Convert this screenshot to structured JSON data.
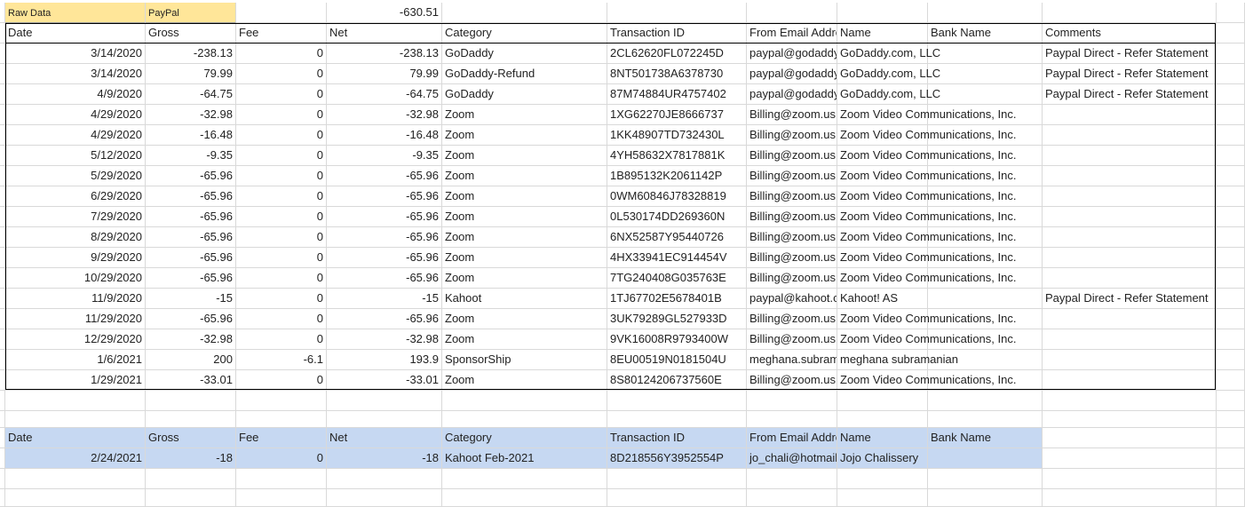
{
  "top_row": {
    "raw_data": "Raw Data",
    "paypal": "PayPal",
    "total": "-630.51"
  },
  "headers": [
    "Date",
    "Gross",
    "Fee",
    "Net",
    "Category",
    "Transaction ID",
    "From Email Address",
    "Name",
    "Bank Name",
    "Comments"
  ],
  "rows": [
    [
      "3/14/2020",
      "-238.13",
      "0",
      "-238.13",
      "GoDaddy",
      "2CL62620FL072245D",
      "paypal@godaddy.com",
      "GoDaddy.com, LLC",
      "",
      "Paypal Direct - Refer Statement"
    ],
    [
      "3/14/2020",
      "79.99",
      "0",
      "79.99",
      "GoDaddy-Refund",
      "8NT501738A6378730",
      "paypal@godaddy.com",
      "GoDaddy.com, LLC",
      "",
      "Paypal Direct - Refer Statement"
    ],
    [
      "4/9/2020",
      "-64.75",
      "0",
      "-64.75",
      "GoDaddy",
      "87M74884UR4757402",
      "paypal@godaddy.com",
      "GoDaddy.com, LLC",
      "",
      "Paypal Direct - Refer Statement"
    ],
    [
      "4/29/2020",
      "-32.98",
      "0",
      "-32.98",
      "Zoom",
      "1XG62270JE8666737",
      "Billing@zoom.us",
      "Zoom Video Communications, Inc.",
      "",
      ""
    ],
    [
      "4/29/2020",
      "-16.48",
      "0",
      "-16.48",
      "Zoom",
      "1KK48907TD732430L",
      "Billing@zoom.us",
      "Zoom Video Communications, Inc.",
      "",
      ""
    ],
    [
      "5/12/2020",
      "-9.35",
      "0",
      "-9.35",
      "Zoom",
      "4YH58632X7817881K",
      "Billing@zoom.us",
      "Zoom Video Communications, Inc.",
      "",
      ""
    ],
    [
      "5/29/2020",
      "-65.96",
      "0",
      "-65.96",
      "Zoom",
      "1B895132K2061142P",
      "Billing@zoom.us",
      "Zoom Video Communications, Inc.",
      "",
      ""
    ],
    [
      "6/29/2020",
      "-65.96",
      "0",
      "-65.96",
      "Zoom",
      "0WM60846J78328819",
      "Billing@zoom.us",
      "Zoom Video Communications, Inc.",
      "",
      ""
    ],
    [
      "7/29/2020",
      "-65.96",
      "0",
      "-65.96",
      "Zoom",
      "0L530174DD269360N",
      "Billing@zoom.us",
      "Zoom Video Communications, Inc.",
      "",
      ""
    ],
    [
      "8/29/2020",
      "-65.96",
      "0",
      "-65.96",
      "Zoom",
      "6NX52587Y95440726",
      "Billing@zoom.us",
      "Zoom Video Communications, Inc.",
      "",
      ""
    ],
    [
      "9/29/2020",
      "-65.96",
      "0",
      "-65.96",
      "Zoom",
      "4HX33941EC914454V",
      "Billing@zoom.us",
      "Zoom Video Communications, Inc.",
      "",
      ""
    ],
    [
      "10/29/2020",
      "-65.96",
      "0",
      "-65.96",
      "Zoom",
      "7TG240408G035763E",
      "Billing@zoom.us",
      "Zoom Video Communications, Inc.",
      "",
      ""
    ],
    [
      "11/9/2020",
      "-15",
      "0",
      "-15",
      "Kahoot",
      "1TJ67702E5678401B",
      "paypal@kahoot.com",
      "Kahoot! AS",
      "",
      "Paypal Direct - Refer Statement"
    ],
    [
      "11/29/2020",
      "-65.96",
      "0",
      "-65.96",
      "Zoom",
      "3UK79289GL527933D",
      "Billing@zoom.us",
      "Zoom Video Communications, Inc.",
      "",
      ""
    ],
    [
      "12/29/2020",
      "-32.98",
      "0",
      "-32.98",
      "Zoom",
      "9VK16008R9793400W",
      "Billing@zoom.us",
      "Zoom Video Communications, Inc.",
      "",
      ""
    ],
    [
      "1/6/2021",
      "200",
      "-6.1",
      "193.9",
      "SponsorShip",
      "8EU00519N0181504U",
      "meghana.subramanian",
      "meghana subramanian",
      "",
      ""
    ],
    [
      "1/29/2021",
      "-33.01",
      "0",
      "-33.01",
      "Zoom",
      "8S80124206737560E",
      "Billing@zoom.us",
      "Zoom Video Communications, Inc.",
      "",
      ""
    ]
  ],
  "second_headers": [
    "Date",
    "Gross",
    "Fee",
    "Net",
    "Category",
    "Transaction ID",
    "From Email Address",
    "Name",
    "Bank Name"
  ],
  "second_rows": [
    [
      "2/24/2021",
      "-18",
      "0",
      "-18",
      "Kahoot Feb-2021",
      "8D218556Y3952554P",
      "jo_chali@hotmail.com",
      "Jojo Chalissery",
      ""
    ]
  ],
  "colors": {
    "tag_yellow": "#ffe699",
    "header_blue": "#c6d8f2",
    "gridline": "#d9d9d9"
  }
}
